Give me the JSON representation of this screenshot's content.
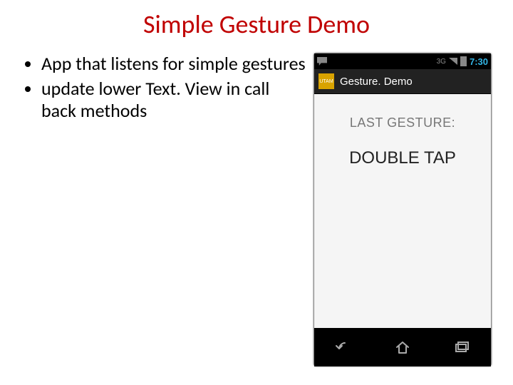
{
  "slide": {
    "title": "Simple Gesture Demo",
    "bullets": [
      "App that listens for simple gestures",
      "update lower Text. View in call back methods"
    ]
  },
  "phone": {
    "statusbar": {
      "network_label": "3G",
      "time": "7:30"
    },
    "appbar": {
      "icon_text": "UTAM",
      "app_name": "Gesture. Demo"
    },
    "body": {
      "label": "LAST GESTURE:",
      "value": "DOUBLE TAP"
    }
  }
}
